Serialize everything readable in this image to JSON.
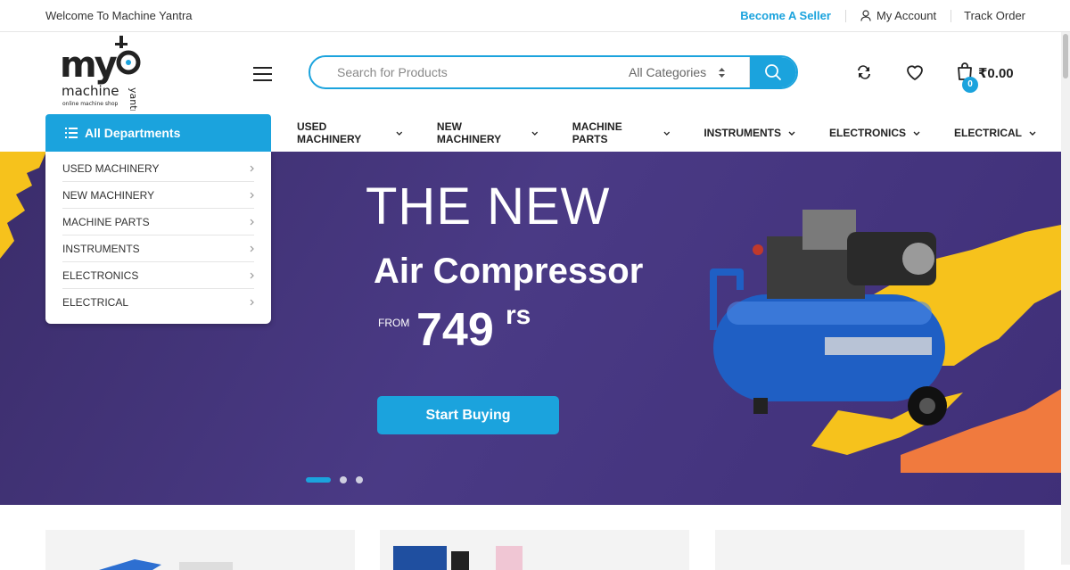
{
  "topbar": {
    "welcome": "Welcome To Machine Yantra",
    "seller_link": "Become A Seller",
    "account_link": "My Account",
    "track_link": "Track Order"
  },
  "logo": {
    "word_my": "my",
    "word_machine": "machine",
    "word_yantra": "yantra",
    "tagline": "online machine shop"
  },
  "search": {
    "placeholder": "Search for Products",
    "category": "All Categories"
  },
  "cart": {
    "total": "₹0.00",
    "count": "0"
  },
  "nav": {
    "departments_label": "All Departments",
    "items": [
      {
        "label": "USED MACHINERY"
      },
      {
        "label": "NEW MACHINERY"
      },
      {
        "label": "MACHINE PARTS"
      },
      {
        "label": "INSTRUMENTS"
      },
      {
        "label": "ELECTRONICS"
      },
      {
        "label": "ELECTRICAL"
      }
    ]
  },
  "departments": [
    {
      "label": "USED MACHINERY"
    },
    {
      "label": "NEW MACHINERY"
    },
    {
      "label": "MACHINE PARTS"
    },
    {
      "label": "INSTRUMENTS"
    },
    {
      "label": "ELECTRONICS"
    },
    {
      "label": "ELECTRICAL"
    }
  ],
  "hero": {
    "line1": "THE NEW",
    "line2": "Air Compressor",
    "from": "FROM",
    "price": "749",
    "currency": "rs",
    "cta": "Start Buying",
    "slide_count": 3,
    "active_slide": 1
  },
  "colors": {
    "accent": "#1ba3dd",
    "hero_bg": "#43337c",
    "splash_yellow": "#f6c21c",
    "splash_orange": "#f07a3e"
  }
}
